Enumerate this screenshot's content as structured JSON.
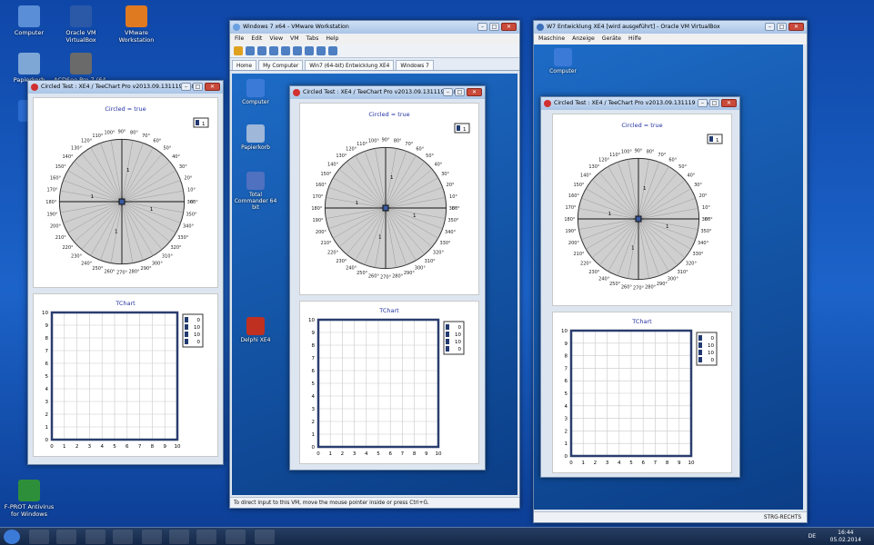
{
  "host_icons": [
    {
      "label": "Computer",
      "x": 0,
      "y": 6
    },
    {
      "label": "Oracle VM VirtualBox",
      "x": 57,
      "y": 6
    },
    {
      "label": "VMware Workstation",
      "x": 118,
      "y": 6
    },
    {
      "label": "Papierkorb",
      "x": 0,
      "y": 58
    },
    {
      "label": "ACDSee Pro 7 (64-bit)",
      "x": 57,
      "y": 58
    },
    {
      "label": "F-PROT Antivirus for Windows",
      "x": 0,
      "y": 528
    }
  ],
  "vmware": {
    "title": "Windows 7 x64 - VMware Workstation",
    "menu": [
      "File",
      "Edit",
      "View",
      "VM",
      "Tabs",
      "Help"
    ],
    "tabs": [
      "Home",
      "My Computer",
      "Win7 (64-bit) Entwicklung XE4",
      "Windows 7"
    ],
    "status": "To direct input to this VM, move the mouse pointer inside or press Ctrl+G.",
    "guest_icons": [
      "Computer",
      "Papierkorb",
      "Total Commander 64 bit",
      "Delphi XE4"
    ]
  },
  "vbox": {
    "title": "W7 Entwicklung XE4 [wird ausgeführt] - Oracle VM VirtualBox",
    "menu": [
      "Maschine",
      "Anzeige",
      "Geräte",
      "Hilfe"
    ],
    "guest_icons": [
      "Computer"
    ],
    "status": "STRG-RECHTS"
  },
  "teechart_window": {
    "title": "Circled Test : XE4 / TeeChart Pro v2013.09.131119 32&..."
  },
  "taskbar": {
    "lang": "DE",
    "time": "16:44",
    "date": "05.02.2014"
  },
  "chart_data": [
    {
      "type": "polar",
      "title": "Circled = true",
      "angle_labels": [
        "0°",
        "10°",
        "20°",
        "30°",
        "40°",
        "50°",
        "60°",
        "70°",
        "80°",
        "90°",
        "100°",
        "110°",
        "120°",
        "130°",
        "140°",
        "150°",
        "160°",
        "170°",
        "180°",
        "190°",
        "200°",
        "210°",
        "220°",
        "230°",
        "240°",
        "250°",
        "260°",
        "270°",
        "280°",
        "290°",
        "300°",
        "310°",
        "320°",
        "330°",
        "340°",
        "350°",
        "360°"
      ],
      "radial_labels": [
        "1",
        "1",
        "1",
        "1"
      ],
      "legend": [
        "1"
      ]
    },
    {
      "type": "line",
      "title": "TChart",
      "xlim": [
        0,
        10
      ],
      "ylim": [
        0,
        10
      ],
      "x_ticks": [
        "0",
        "1",
        "2",
        "3",
        "4",
        "5",
        "6",
        "7",
        "8",
        "9",
        "10"
      ],
      "y_ticks": [
        "0",
        "1",
        "2",
        "3",
        "4",
        "5",
        "6",
        "7",
        "8",
        "9",
        "10"
      ],
      "legend": [
        "0",
        "10",
        "10",
        "0"
      ],
      "grid": true
    }
  ]
}
